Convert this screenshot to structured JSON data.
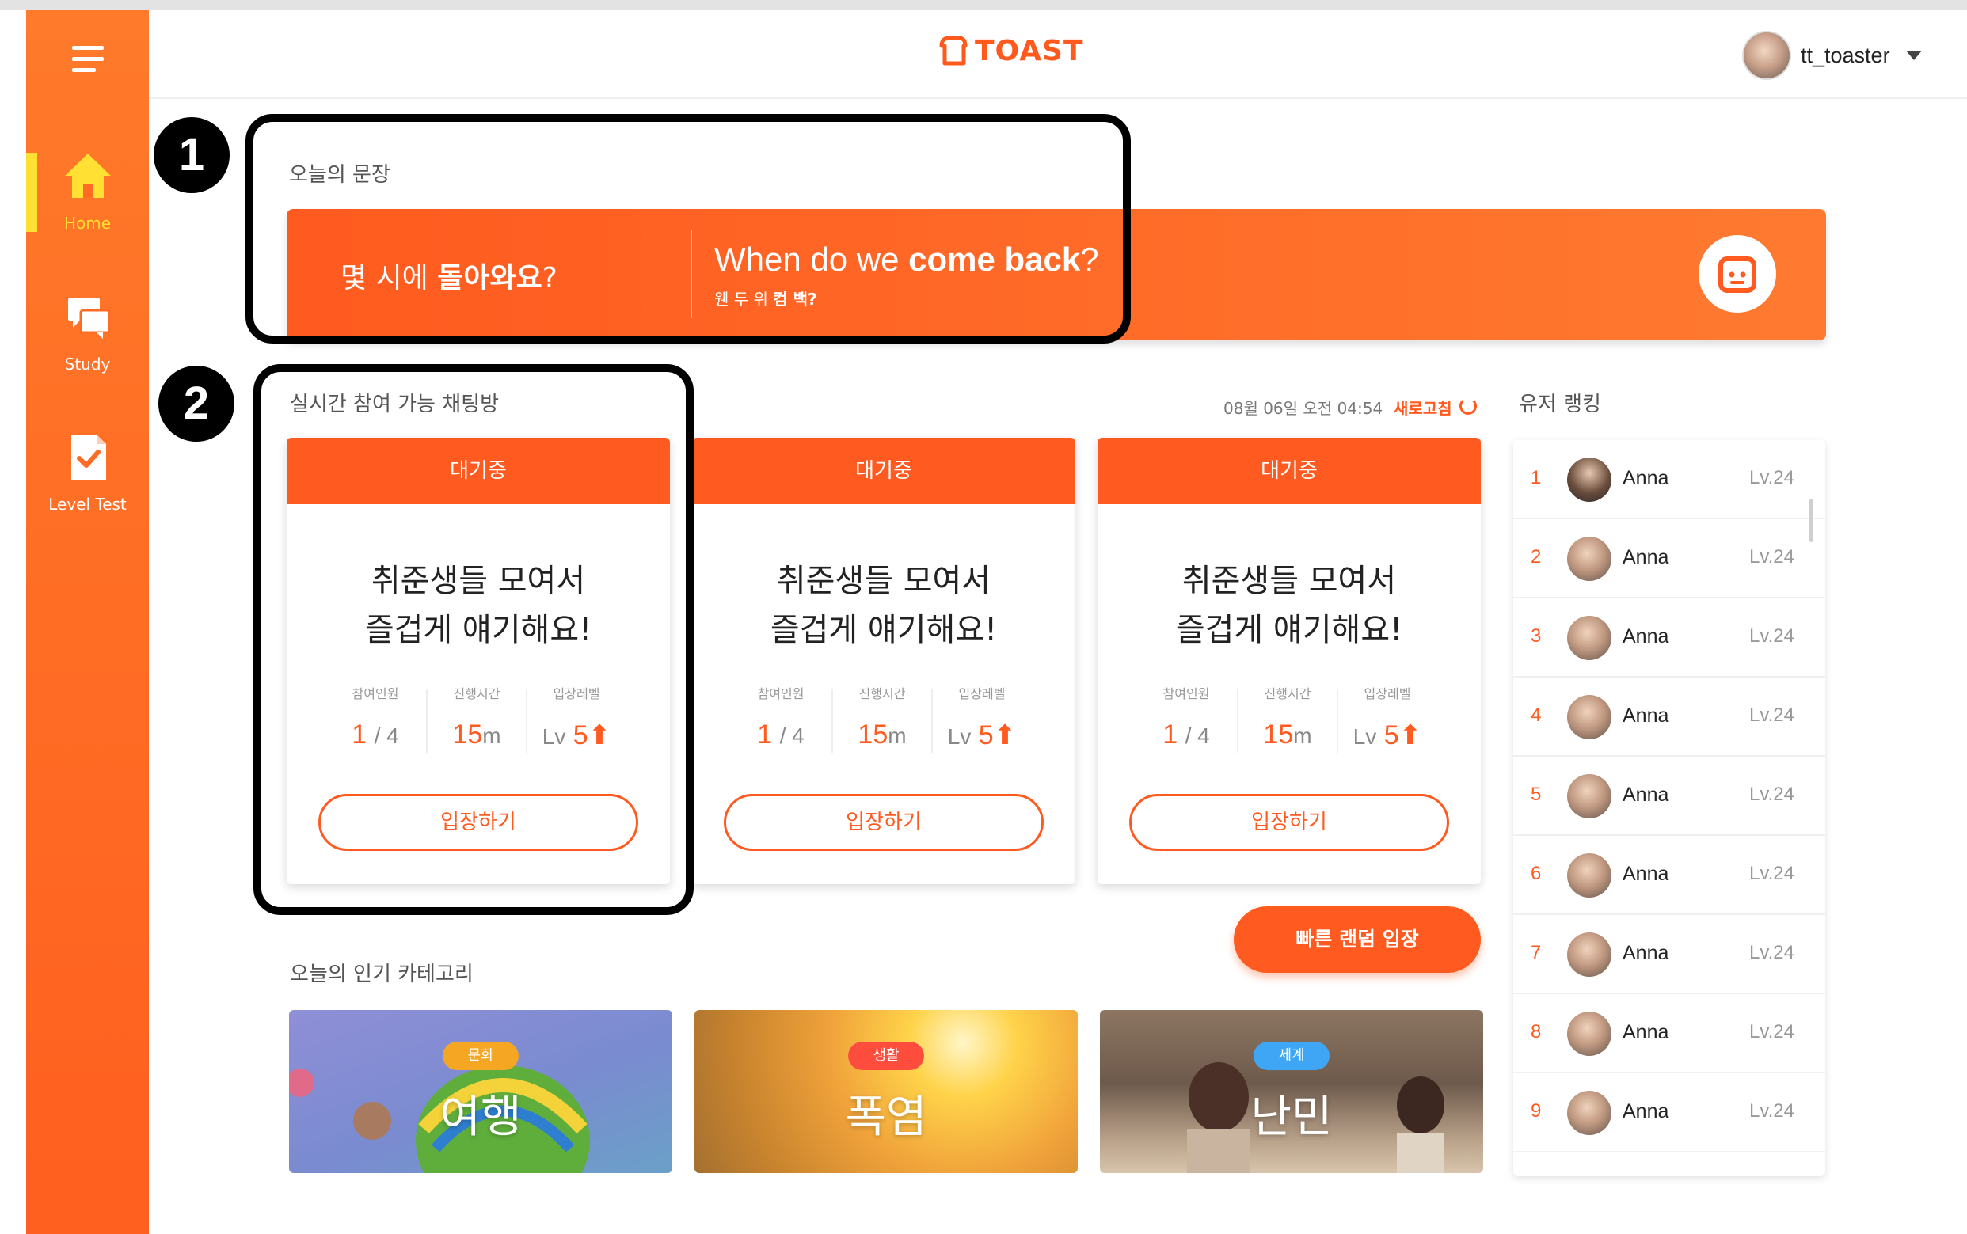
{
  "app": {
    "logo": "TOAST",
    "user": {
      "name": "tt_toaster"
    }
  },
  "sidebar": {
    "items": [
      {
        "label": "Home",
        "icon": "home-icon",
        "active": true
      },
      {
        "label": "Study",
        "icon": "chat-bubbles-icon",
        "active": false
      },
      {
        "label": "Level Test",
        "icon": "checklist-icon",
        "active": false
      }
    ]
  },
  "sentence": {
    "section_title": "오늘의 문장",
    "korean_plain": "몇 시에 ",
    "korean_bold": "돌아와요",
    "korean_end": "?",
    "english_plain": "When do we ",
    "english_bold": "come back",
    "english_end": "?",
    "pron_plain": "웬 두 위 ",
    "pron_bold": "컴 백?"
  },
  "chat": {
    "section_title": "실시간 참여 가능 채팅방",
    "timestamp": "08월 06일 오전 04:54",
    "refresh_label": "새로고침",
    "stat_labels": [
      "참여인원",
      "진행시간",
      "입장레벨"
    ],
    "rooms": [
      {
        "status": "대기중",
        "title1": "취준생들 모여서",
        "title2": "즐겁게 얘기해요!",
        "participants": "1",
        "capacity": "/ 4",
        "time": "15",
        "time_unit": "m",
        "lv_prefix": "Lv",
        "level": "5",
        "enter": "입장하기"
      },
      {
        "status": "대기중",
        "title1": "취준생들 모여서",
        "title2": "즐겁게 얘기해요!",
        "participants": "1",
        "capacity": "/ 4",
        "time": "15",
        "time_unit": "m",
        "lv_prefix": "Lv",
        "level": "5",
        "enter": "입장하기"
      },
      {
        "status": "대기중",
        "title1": "취준생들 모여서",
        "title2": "즐겁게 얘기해요!",
        "participants": "1",
        "capacity": "/ 4",
        "time": "15",
        "time_unit": "m",
        "lv_prefix": "Lv",
        "level": "5",
        "enter": "입장하기"
      }
    ],
    "random_button": "빠른 랜덤 입장"
  },
  "ranking": {
    "section_title": "유저 랭킹",
    "users": [
      {
        "rank": "1",
        "name": "Anna",
        "level": "Lv.24"
      },
      {
        "rank": "2",
        "name": "Anna",
        "level": "Lv.24"
      },
      {
        "rank": "3",
        "name": "Anna",
        "level": "Lv.24"
      },
      {
        "rank": "4",
        "name": "Anna",
        "level": "Lv.24"
      },
      {
        "rank": "5",
        "name": "Anna",
        "level": "Lv.24"
      },
      {
        "rank": "6",
        "name": "Anna",
        "level": "Lv.24"
      },
      {
        "rank": "7",
        "name": "Anna",
        "level": "Lv.24"
      },
      {
        "rank": "8",
        "name": "Anna",
        "level": "Lv.24"
      },
      {
        "rank": "9",
        "name": "Anna",
        "level": "Lv.24"
      }
    ]
  },
  "categories": {
    "section_title": "오늘의 인기 카테고리",
    "items": [
      {
        "badge": "문화",
        "title": "여행",
        "badge_color": "#f5a623"
      },
      {
        "badge": "생활",
        "title": "폭염",
        "badge_color": "#ff4d3d"
      },
      {
        "badge": "세계",
        "title": "난민",
        "badge_color": "#3fa6f5"
      }
    ]
  },
  "annotations": [
    "1",
    "2"
  ],
  "colors": {
    "accent": "#ff5a1f",
    "sidebar_top": "#ff7a2a",
    "active_nav": "#ffe033"
  }
}
